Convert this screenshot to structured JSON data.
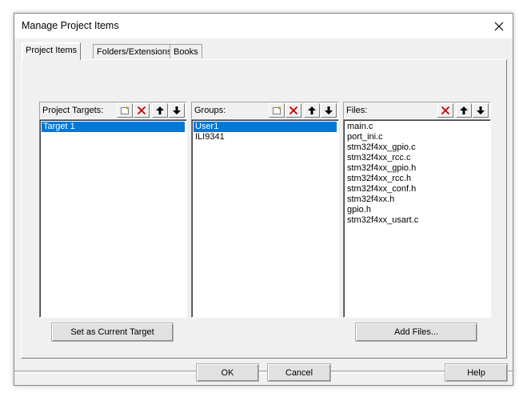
{
  "window": {
    "title": "Manage Project Items"
  },
  "tabs": [
    {
      "label": "Project Items",
      "active": true
    },
    {
      "label": "Folders/Extensions",
      "active": false
    },
    {
      "label": "Books",
      "active": false
    }
  ],
  "targets": {
    "label": "Project Targets:",
    "items": [
      "Target 1"
    ],
    "selected_index": 0,
    "button_label": "Set as Current Target"
  },
  "groups": {
    "label": "Groups:",
    "items": [
      "User1",
      "ILI9341"
    ],
    "selected_index": 0
  },
  "files": {
    "label": "Files:",
    "items": [
      "main.c",
      "port_ini.c",
      "stm32f4xx_gpio.c",
      "stm32f4xx_rcc.c",
      "stm32f4xx_gpio.h",
      "stm32f4xx_rcc.h",
      "stm32f4xx_conf.h",
      "stm32f4xx.h",
      "gpio.h",
      "stm32f4xx_usart.c"
    ],
    "button_label": "Add Files..."
  },
  "footer": {
    "ok_label": "OK",
    "cancel_label": "Cancel",
    "help_label": "Help"
  },
  "colors": {
    "selection": "#0078d7",
    "delete_icon": "#c00000"
  }
}
